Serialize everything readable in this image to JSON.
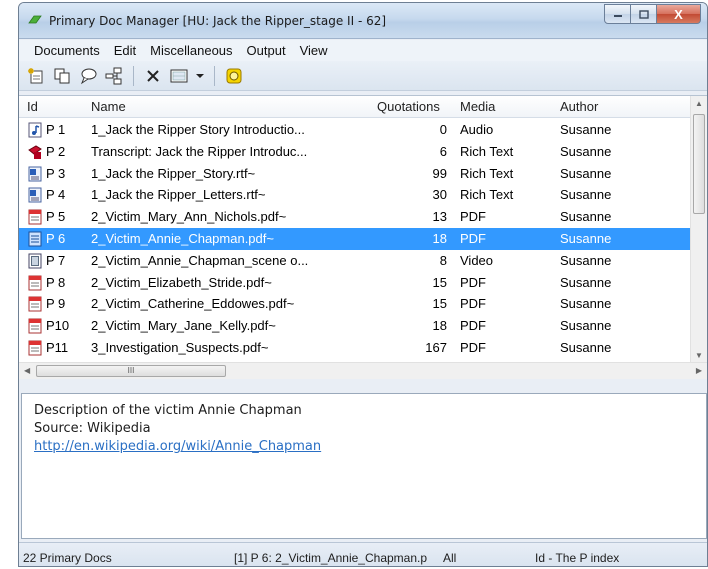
{
  "window": {
    "title": "Primary Doc Manager [HU: Jack the Ripper_stage II - 62]",
    "minimize": "–",
    "maximize": "□",
    "close": "X"
  },
  "menu": [
    "Documents",
    "Edit",
    "Miscellaneous",
    "Output",
    "View"
  ],
  "toolbar": {
    "icons": [
      "new-doc-icon",
      "copy-icon",
      "comment-icon",
      "tree-icon",
      "delete-icon",
      "display-icon",
      "dropdown-icon",
      "target-icon"
    ]
  },
  "list": {
    "columns": [
      "Id",
      "Name",
      "Quotations",
      "Media",
      "Author"
    ],
    "rows": [
      {
        "icon": "audio",
        "id": "P 1",
        "name": "1_Jack the Ripper Story Introductio...",
        "quotations": "0",
        "media": "Audio",
        "author": "Susanne"
      },
      {
        "icon": "transcript",
        "id": "P 2",
        "name": "Transcript: Jack the Ripper Introduc...",
        "quotations": "6",
        "media": "Rich Text",
        "author": "Susanne"
      },
      {
        "icon": "richtext",
        "id": "P 3",
        "name": "1_Jack the Ripper_Story.rtf~",
        "quotations": "99",
        "media": "Rich Text",
        "author": "Susanne"
      },
      {
        "icon": "richtext",
        "id": "P 4",
        "name": "1_Jack the Ripper_Letters.rtf~",
        "quotations": "30",
        "media": "Rich Text",
        "author": "Susanne"
      },
      {
        "icon": "pdf",
        "id": "P 5",
        "name": "2_Victim_Mary_Ann_Nichols.pdf~",
        "quotations": "13",
        "media": "PDF",
        "author": "Susanne"
      },
      {
        "icon": "pdf",
        "id": "P 6",
        "name": "2_Victim_Annie_Chapman.pdf~",
        "quotations": "18",
        "media": "PDF",
        "author": "Susanne",
        "selected": true
      },
      {
        "icon": "video",
        "id": "P 7",
        "name": "2_Victim_Annie_Chapman_scene o...",
        "quotations": "8",
        "media": "Video",
        "author": "Susanne"
      },
      {
        "icon": "pdf",
        "id": "P 8",
        "name": "2_Victim_Elizabeth_Stride.pdf~",
        "quotations": "15",
        "media": "PDF",
        "author": "Susanne"
      },
      {
        "icon": "pdf",
        "id": "P 9",
        "name": "2_Victim_Catherine_Eddowes.pdf~",
        "quotations": "15",
        "media": "PDF",
        "author": "Susanne"
      },
      {
        "icon": "pdf",
        "id": "P10",
        "name": "2_Victim_Mary_Jane_Kelly.pdf~",
        "quotations": "18",
        "media": "PDF",
        "author": "Susanne"
      },
      {
        "icon": "pdf",
        "id": "P11",
        "name": "3_Investigation_Suspects.pdf~",
        "quotations": "167",
        "media": "PDF",
        "author": "Susanne"
      }
    ],
    "hscroll_grip": "III"
  },
  "description": {
    "line1": "Description of the victim Annie Chapman",
    "line2": "Source: Wikipedia",
    "link": "http://en.wikipedia.org/wiki/Annie_Chapman"
  },
  "status": {
    "count": "22 Primary Docs",
    "selection": "[1] P 6: 2_Victim_Annie_Chapman.p",
    "filter": "All",
    "sort": "Id - The P index"
  },
  "colors": {
    "selection": "#3399ff",
    "link": "#2a6fc4",
    "close_button": "#c24a33"
  }
}
